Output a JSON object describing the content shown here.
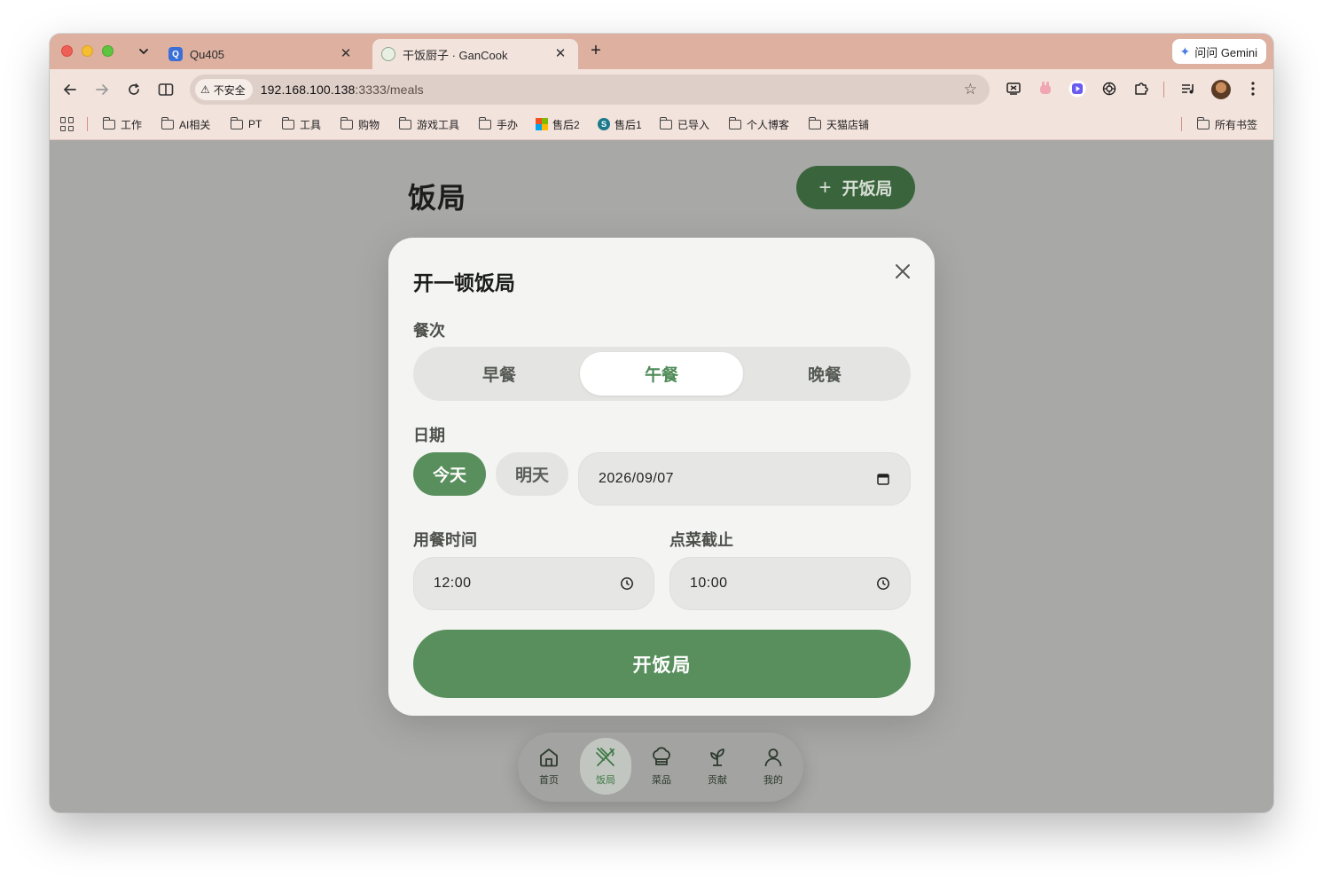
{
  "browser": {
    "tabs": [
      {
        "title": "Qu405",
        "favicon": "q-app-icon"
      },
      {
        "title": "干饭厨子 · GanCook",
        "favicon": "gancook-icon",
        "active": true
      }
    ],
    "gemini_label": "问问 Gemini",
    "security_label": "不安全",
    "url_host": "192.168.100.138",
    "url_rest": ":3333/meals",
    "bookmarks": [
      "工作",
      "AI相关",
      "PT",
      "工具",
      "购物",
      "游戏工具",
      "手办",
      "售后2",
      "售后1",
      "已导入",
      "个人博客",
      "天猫店铺"
    ],
    "all_bookmarks": "所有书签"
  },
  "page": {
    "title": "饭局",
    "new_meal_button": "开饭局",
    "bottom_nav": [
      {
        "label": "首页",
        "icon": "home-icon"
      },
      {
        "label": "饭局",
        "icon": "utensils-icon",
        "active": true
      },
      {
        "label": "菜品",
        "icon": "chef-hat-icon"
      },
      {
        "label": "贡献",
        "icon": "sprout-icon"
      },
      {
        "label": "我的",
        "icon": "user-icon"
      }
    ]
  },
  "modal": {
    "title": "开一顿饭局",
    "meal_label": "餐次",
    "meal_options": [
      "早餐",
      "午餐",
      "晚餐"
    ],
    "meal_selected": "午餐",
    "date_label": "日期",
    "date_today": "今天",
    "date_tomorrow": "明天",
    "date_value": "2026/09/07",
    "meal_time_label": "用餐时间",
    "meal_time_value": "12:00",
    "order_deadline_label": "点菜截止",
    "order_deadline_value": "10:00",
    "submit_label": "开饭局"
  },
  "colors": {
    "accent": "#588f5c",
    "accent_dark": "#3a643c",
    "tab_strip": "#ddb0a0",
    "toolbar": "#f3e3dd"
  }
}
